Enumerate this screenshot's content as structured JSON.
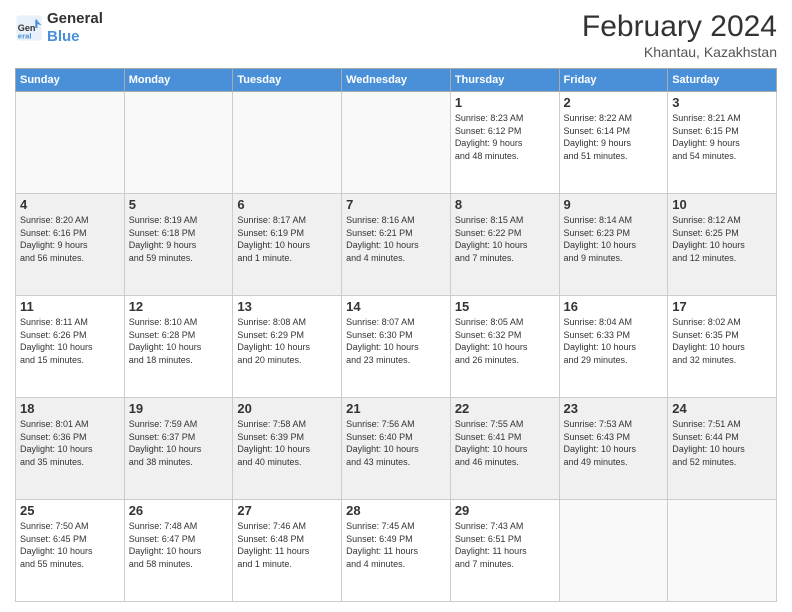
{
  "header": {
    "logo_line1": "General",
    "logo_line2": "Blue",
    "month_title": "February 2024",
    "location": "Khantau, Kazakhstan"
  },
  "weekdays": [
    "Sunday",
    "Monday",
    "Tuesday",
    "Wednesday",
    "Thursday",
    "Friday",
    "Saturday"
  ],
  "weeks": [
    [
      {
        "day": "",
        "info": ""
      },
      {
        "day": "",
        "info": ""
      },
      {
        "day": "",
        "info": ""
      },
      {
        "day": "",
        "info": ""
      },
      {
        "day": "1",
        "info": "Sunrise: 8:23 AM\nSunset: 6:12 PM\nDaylight: 9 hours\nand 48 minutes."
      },
      {
        "day": "2",
        "info": "Sunrise: 8:22 AM\nSunset: 6:14 PM\nDaylight: 9 hours\nand 51 minutes."
      },
      {
        "day": "3",
        "info": "Sunrise: 8:21 AM\nSunset: 6:15 PM\nDaylight: 9 hours\nand 54 minutes."
      }
    ],
    [
      {
        "day": "4",
        "info": "Sunrise: 8:20 AM\nSunset: 6:16 PM\nDaylight: 9 hours\nand 56 minutes."
      },
      {
        "day": "5",
        "info": "Sunrise: 8:19 AM\nSunset: 6:18 PM\nDaylight: 9 hours\nand 59 minutes."
      },
      {
        "day": "6",
        "info": "Sunrise: 8:17 AM\nSunset: 6:19 PM\nDaylight: 10 hours\nand 1 minute."
      },
      {
        "day": "7",
        "info": "Sunrise: 8:16 AM\nSunset: 6:21 PM\nDaylight: 10 hours\nand 4 minutes."
      },
      {
        "day": "8",
        "info": "Sunrise: 8:15 AM\nSunset: 6:22 PM\nDaylight: 10 hours\nand 7 minutes."
      },
      {
        "day": "9",
        "info": "Sunrise: 8:14 AM\nSunset: 6:23 PM\nDaylight: 10 hours\nand 9 minutes."
      },
      {
        "day": "10",
        "info": "Sunrise: 8:12 AM\nSunset: 6:25 PM\nDaylight: 10 hours\nand 12 minutes."
      }
    ],
    [
      {
        "day": "11",
        "info": "Sunrise: 8:11 AM\nSunset: 6:26 PM\nDaylight: 10 hours\nand 15 minutes."
      },
      {
        "day": "12",
        "info": "Sunrise: 8:10 AM\nSunset: 6:28 PM\nDaylight: 10 hours\nand 18 minutes."
      },
      {
        "day": "13",
        "info": "Sunrise: 8:08 AM\nSunset: 6:29 PM\nDaylight: 10 hours\nand 20 minutes."
      },
      {
        "day": "14",
        "info": "Sunrise: 8:07 AM\nSunset: 6:30 PM\nDaylight: 10 hours\nand 23 minutes."
      },
      {
        "day": "15",
        "info": "Sunrise: 8:05 AM\nSunset: 6:32 PM\nDaylight: 10 hours\nand 26 minutes."
      },
      {
        "day": "16",
        "info": "Sunrise: 8:04 AM\nSunset: 6:33 PM\nDaylight: 10 hours\nand 29 minutes."
      },
      {
        "day": "17",
        "info": "Sunrise: 8:02 AM\nSunset: 6:35 PM\nDaylight: 10 hours\nand 32 minutes."
      }
    ],
    [
      {
        "day": "18",
        "info": "Sunrise: 8:01 AM\nSunset: 6:36 PM\nDaylight: 10 hours\nand 35 minutes."
      },
      {
        "day": "19",
        "info": "Sunrise: 7:59 AM\nSunset: 6:37 PM\nDaylight: 10 hours\nand 38 minutes."
      },
      {
        "day": "20",
        "info": "Sunrise: 7:58 AM\nSunset: 6:39 PM\nDaylight: 10 hours\nand 40 minutes."
      },
      {
        "day": "21",
        "info": "Sunrise: 7:56 AM\nSunset: 6:40 PM\nDaylight: 10 hours\nand 43 minutes."
      },
      {
        "day": "22",
        "info": "Sunrise: 7:55 AM\nSunset: 6:41 PM\nDaylight: 10 hours\nand 46 minutes."
      },
      {
        "day": "23",
        "info": "Sunrise: 7:53 AM\nSunset: 6:43 PM\nDaylight: 10 hours\nand 49 minutes."
      },
      {
        "day": "24",
        "info": "Sunrise: 7:51 AM\nSunset: 6:44 PM\nDaylight: 10 hours\nand 52 minutes."
      }
    ],
    [
      {
        "day": "25",
        "info": "Sunrise: 7:50 AM\nSunset: 6:45 PM\nDaylight: 10 hours\nand 55 minutes."
      },
      {
        "day": "26",
        "info": "Sunrise: 7:48 AM\nSunset: 6:47 PM\nDaylight: 10 hours\nand 58 minutes."
      },
      {
        "day": "27",
        "info": "Sunrise: 7:46 AM\nSunset: 6:48 PM\nDaylight: 11 hours\nand 1 minute."
      },
      {
        "day": "28",
        "info": "Sunrise: 7:45 AM\nSunset: 6:49 PM\nDaylight: 11 hours\nand 4 minutes."
      },
      {
        "day": "29",
        "info": "Sunrise: 7:43 AM\nSunset: 6:51 PM\nDaylight: 11 hours\nand 7 minutes."
      },
      {
        "day": "",
        "info": ""
      },
      {
        "day": "",
        "info": ""
      }
    ]
  ]
}
